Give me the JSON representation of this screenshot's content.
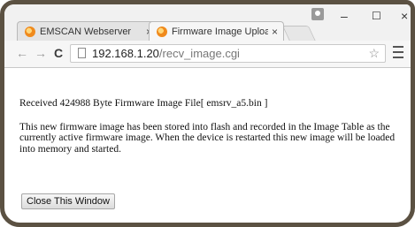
{
  "tabs": [
    {
      "title": "EMSCAN Webserver",
      "close": "×",
      "active": false
    },
    {
      "title": "Firmware Image Upload R",
      "close": "×",
      "active": true
    }
  ],
  "window_controls": {
    "minimize": "–",
    "maximize": "☐",
    "close": "×"
  },
  "toolbar": {
    "back": "←",
    "forward": "→",
    "reload": "C",
    "url_host": "192.168.1.20",
    "url_path": "/recv_image.cgi",
    "star": "☆"
  },
  "page": {
    "received_line": "Received 424988 Byte Firmware Image File[ emsrv_a5.bin ]",
    "description": "This new firmware image has been stored into flash and recorded in the Image Table as the currently active firmware image. When the device is restarted this new image will be loaded into memory and started.",
    "close_button": "Close This Window"
  },
  "colors": {
    "frame": "#5b5142",
    "favicon": "#f08a1c"
  }
}
